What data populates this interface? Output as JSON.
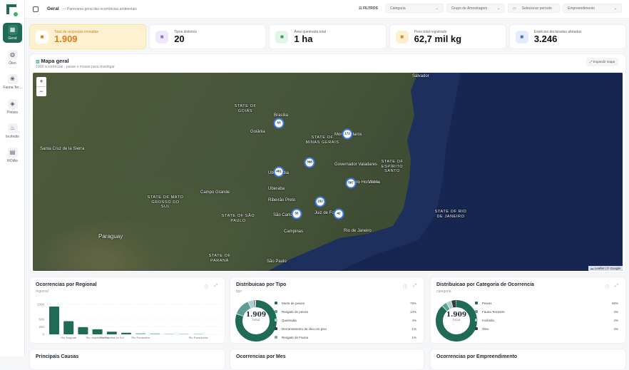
{
  "sidebar": {
    "items": [
      {
        "label": "Geral",
        "icon": "grid-icon"
      },
      {
        "label": "Óleo",
        "icon": "droplets-icon"
      },
      {
        "label": "Fauna Ter...",
        "icon": "paw-icon"
      },
      {
        "label": "Peixes",
        "icon": "fish-icon"
      },
      {
        "label": "Incêndio",
        "icon": "flame-icon"
      },
      {
        "label": "ROIAs",
        "icon": "document-icon"
      }
    ]
  },
  "header": {
    "title": "Geral",
    "subtitle": "— Panorama geral das ocorrências ambientais",
    "filters_label": "FILTROS",
    "filters": {
      "categoria": "Categoria",
      "grupo": "Grupo de Amostragem",
      "periodo": "Selecionar período",
      "empreendimento": "Empreendimento"
    }
  },
  "kpis": [
    {
      "label": "Total de respostas enviadas",
      "value": "1.909",
      "icon": "file-icon",
      "color": "#e07a1a"
    },
    {
      "label": "Tipos distintos",
      "value": "20",
      "icon": "layers-icon",
      "color": "#8b6fd6"
    },
    {
      "label": "Área queimada total",
      "value": "1 ha",
      "icon": "map-icon",
      "color": "#2e9e5b"
    },
    {
      "label": "Peso total registrado",
      "value": "62,7 mil kg",
      "icon": "weight-icon",
      "color": "#e08a1a"
    },
    {
      "label": "Espécies declaradas afetadas",
      "value": "3.246",
      "icon": "species-icon",
      "color": "#3d6fe0"
    }
  ],
  "map": {
    "title": "Mapa geral",
    "subtitle": "1908 ocorrências · passe o mouse para investigar",
    "expand_label": "Expandir mapa",
    "zoom_in": "+",
    "zoom_out": "−",
    "attribution": "Leaflet | © Google",
    "clusters": [
      "63",
      "172",
      "368",
      "461",
      "567",
      "152",
      "55",
      "42"
    ],
    "places": [
      "Salvador",
      "Brasília",
      "Goiânia",
      "Belo Horizonte",
      "Rio de Janeiro",
      "São Paulo",
      "Campinas",
      "Uberlândia",
      "Uberaba",
      "Montes Claros",
      "Governador Valadares",
      "Juiz de Fora",
      "São Carlos",
      "Ribeirão Preto",
      "Campo Grande",
      "Santa Cruz de la Sierra",
      "Paraguay",
      "Vitória"
    ],
    "states": [
      "STATE OF GOIÁS",
      "STATE OF MINAS GERAIS",
      "STATE OF MATO GROSSO DO SUL",
      "STATE OF SÃO PAULO",
      "STATE OF ESPÍRITO SANTO",
      "STATE OF PARANÁ",
      "STATE OF RIO DE JANEIRO"
    ]
  },
  "regional": {
    "title": "Ocorrencias por Regional",
    "subtitle": "regional",
    "chart_data": {
      "type": "bar",
      "ylim": [
        0,
        1000
      ],
      "yticks": [
        "1000",
        "500",
        "250",
        "0"
      ],
      "categories": [
        "",
        "Rio Araguari",
        "",
        "Rio Jequitinhonha",
        "Rio Paraíba do Sul",
        "",
        "Rio Paranaíba",
        "",
        "",
        "",
        "Rio Paraopeba"
      ],
      "values": [
        930,
        440,
        240,
        170,
        90,
        55,
        35,
        30,
        15,
        5,
        3
      ]
    }
  },
  "tipo": {
    "title": "Distribuicao por Tipo",
    "subtitle": "tipo",
    "total": "1.909",
    "total_label": "total",
    "chart_data": {
      "type": "pie",
      "items": [
        {
          "label": "Morte de peixes",
          "pct": "79%",
          "value": 79,
          "color": "#1f6b55"
        },
        {
          "label": "Resgate de peixes",
          "pct": "13%",
          "value": 13,
          "color": "#5e9e97"
        },
        {
          "label": "Queimada",
          "pct": "4%",
          "value": 4,
          "color": "#a9cfd0"
        },
        {
          "label": "Derramamento de óleo em piso",
          "pct": "1%",
          "value": 1,
          "color": "#333c3a"
        },
        {
          "label": "Resgate de Fauna",
          "pct": "1%",
          "value": 1,
          "color": "#7aa9b0"
        }
      ]
    }
  },
  "categoria": {
    "title": "Distribuicao por Categoria de Ocorrencia",
    "subtitle": "categoria",
    "total": "1.909",
    "total_label": "total",
    "chart_data": {
      "type": "pie",
      "items": [
        {
          "label": "Peixes",
          "pct": "88%",
          "value": 88,
          "color": "#1f6b55"
        },
        {
          "label": "Fauna Terrestre",
          "pct": "4%",
          "value": 4,
          "color": "#5e9e97"
        },
        {
          "label": "Incêndio",
          "pct": "4%",
          "value": 4,
          "color": "#a9cfd0"
        },
        {
          "label": "Óleo",
          "pct": "4%",
          "value": 4,
          "color": "#333c3a"
        }
      ]
    }
  },
  "lower": [
    "Principais Causas",
    "Ocorrencias por Mes",
    "Ocorrencias por Empreendimento"
  ]
}
